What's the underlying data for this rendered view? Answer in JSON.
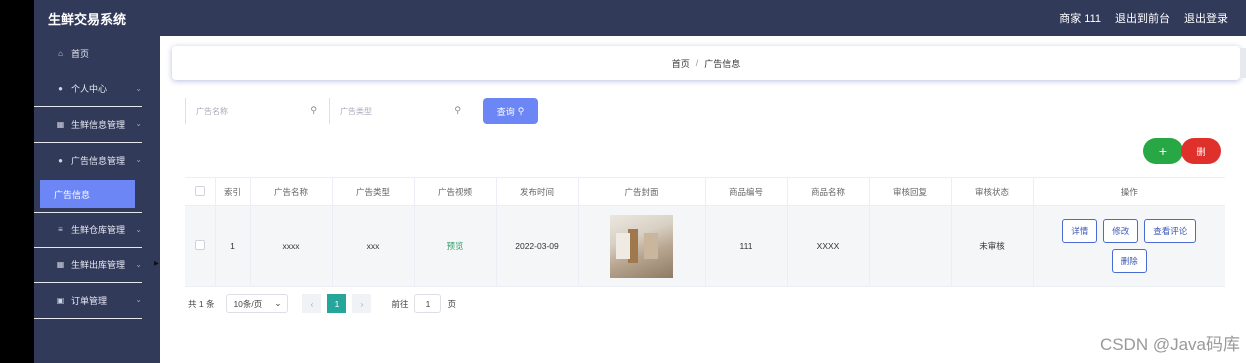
{
  "app": {
    "title": "生鲜交易系统"
  },
  "top_links": [
    "商家 111",
    "退出到前台",
    "退出登录"
  ],
  "sidebar": {
    "items": [
      {
        "icon": "home-icon",
        "glyph": "⌂",
        "label": "首页",
        "chevron": false
      },
      {
        "icon": "user-icon",
        "glyph": "●",
        "label": "个人中心",
        "chevron": true
      },
      {
        "icon": "grid-icon",
        "glyph": "▦",
        "label": "生鲜信息管理",
        "chevron": true
      },
      {
        "icon": "user-icon",
        "glyph": "●",
        "label": "广告信息管理",
        "chevron": true
      },
      {
        "icon": "list-icon",
        "glyph": "≡",
        "label": "生鲜仓库管理",
        "chevron": true
      },
      {
        "icon": "grid-icon",
        "glyph": "▦",
        "label": "生鲜出库管理",
        "chevron": true
      },
      {
        "icon": "doc-icon",
        "glyph": "▣",
        "label": "订单管理",
        "chevron": true
      }
    ],
    "active_sub": "广告信息"
  },
  "breadcrumb": {
    "home": "首页",
    "sep": "/",
    "current": "广告信息"
  },
  "search": {
    "name_placeholder": "广告名称",
    "type_placeholder": "广告类型",
    "button_label": "查询"
  },
  "actions": {
    "add_label": "+",
    "delete_label": "删"
  },
  "table": {
    "headers": [
      "索引",
      "广告名称",
      "广告类型",
      "广告视频",
      "发布时间",
      "广告封面",
      "商品编号",
      "商品名称",
      "审核回复",
      "审核状态",
      "操作"
    ],
    "rows": [
      {
        "index": "1",
        "name": "xxxx",
        "type": "xxx",
        "video": "预览",
        "publish_time": "2022-03-09",
        "product_no": "111",
        "product_name": "XXXX",
        "reply": "",
        "status": "未审核",
        "ops": [
          "详情",
          "修改",
          "查看评论",
          "删除"
        ]
      }
    ]
  },
  "pager": {
    "total": "共 1 条",
    "page_size": "10条/页",
    "current_page": "1",
    "goto_label": "前往",
    "goto_value": "1",
    "page_suffix": "页"
  },
  "watermark": "CSDN @Java码库",
  "colors": {
    "sidebar_bg": "#323a5a",
    "accent": "#6c86f6",
    "add": "#28a745",
    "delete": "#e0302c",
    "pager_active": "#26a69a"
  }
}
